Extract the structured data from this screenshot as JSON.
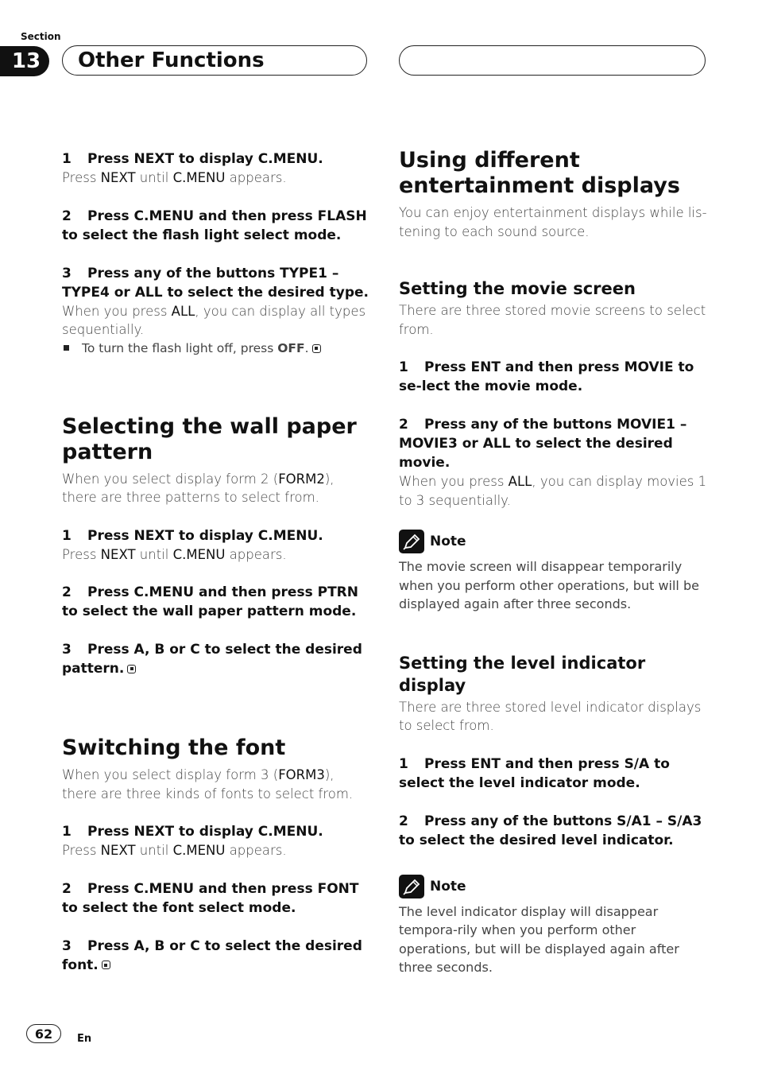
{
  "header": {
    "section_label": "Section",
    "section_number": "13",
    "section_title": "Other Functions"
  },
  "left": {
    "intro_steps": [
      {
        "num": "1",
        "title": "Press NEXT to display C.MENU.",
        "body_parts": [
          "Press ",
          "NEXT",
          " until ",
          "C.MENU",
          " appears."
        ]
      },
      {
        "num": "2",
        "title": "Press C.MENU and then press FLASH to select the flash light select mode."
      },
      {
        "num": "3",
        "title": "Press any of the buttons TYPE1 – TYPE4 or ALL to select the desired type.",
        "body_parts": [
          "When you press ",
          "ALL",
          ", you can display all types sequentially."
        ]
      }
    ],
    "bullet": {
      "pre": "To turn the flash light off, press ",
      "bold": "OFF",
      "post": "."
    },
    "wallpaper": {
      "heading": "Selecting the wall paper pattern",
      "intro_pre": "When you select display form 2 (",
      "intro_bold": "FORM2",
      "intro_post": "), there are three patterns to select from.",
      "steps": [
        {
          "num": "1",
          "title": "Press NEXT to display C.MENU.",
          "body_parts": [
            "Press ",
            "NEXT",
            " until ",
            "C.MENU",
            " appears."
          ]
        },
        {
          "num": "2",
          "title": "Press C.MENU and then press PTRN to select the wall paper pattern mode."
        },
        {
          "num": "3",
          "title": "Press A, B or C to select the desired pattern."
        }
      ]
    },
    "font": {
      "heading": "Switching the font",
      "intro_pre": "When you select display form 3 (",
      "intro_bold": "FORM3",
      "intro_post": "), there are three kinds of fonts to select from.",
      "steps": [
        {
          "num": "1",
          "title": "Press NEXT to display C.MENU.",
          "body_parts": [
            "Press ",
            "NEXT",
            " until ",
            "C.MENU",
            " appears."
          ]
        },
        {
          "num": "2",
          "title": "Press C.MENU and then press FONT to select the font select mode."
        },
        {
          "num": "3",
          "title": "Press A, B or C to select the desired font."
        }
      ]
    }
  },
  "right": {
    "heading": "Using different entertainment displays",
    "intro": "You can enjoy entertainment displays while lis-tening to each sound source.",
    "movie": {
      "heading": "Setting the movie screen",
      "intro": "There are three stored movie screens to select from.",
      "steps": [
        {
          "num": "1",
          "title": "Press ENT and then press MOVIE to se-lect the movie mode."
        },
        {
          "num": "2",
          "title": "Press any of the buttons MOVIE1 – MOVIE3 or ALL to select the desired movie.",
          "body_parts": [
            "When you press ",
            "ALL",
            ", you can display movies 1 to 3 sequentially."
          ]
        }
      ],
      "note_label": "Note",
      "note_text": "The movie screen will disappear temporarily when you perform other operations, but will be displayed again after three seconds."
    },
    "level": {
      "heading": "Setting the level indicator display",
      "intro": "There are three stored level indicator displays to select from.",
      "steps": [
        {
          "num": "1",
          "title": "Press ENT and then press S/A to select the level indicator mode."
        },
        {
          "num": "2",
          "title": "Press any of the buttons S/A1 – S/A3 to select the desired level indicator."
        }
      ],
      "note_label": "Note",
      "note_text": "The level indicator display will disappear tempora-rily when you perform other operations, but will be displayed again after three seconds."
    }
  },
  "footer": {
    "page_number": "62",
    "language": "En"
  }
}
